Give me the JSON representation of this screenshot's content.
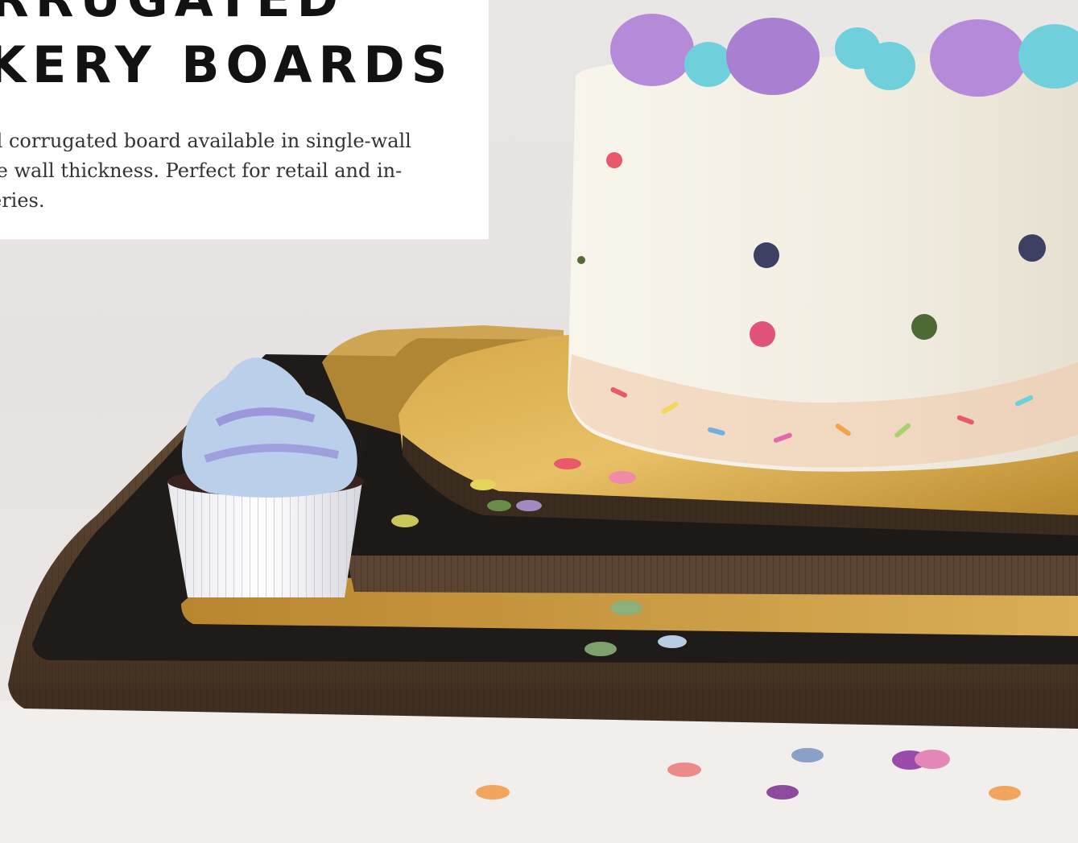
{
  "hero": {
    "heading_line1": "RRUGATED",
    "heading_line2": "KERY BOARDS",
    "description_lines": [
      "d corrugated board available in single-wall",
      "le wall thickness. Perfect for retail and in-",
      "eries."
    ]
  },
  "colors": {
    "background": "#ece8e6",
    "card": "#ffffff",
    "heading_text": "#121212",
    "body_text": "#333333",
    "board_black": "#1f1b19",
    "board_gold": "#c99a3a",
    "cardboard_edge": "#5a4330",
    "frosting_purple": "#b48ad9",
    "frosting_teal": "#6fd0dc",
    "frosting_blue": "#b9cfea",
    "cake_frosting": "#f3efe4"
  },
  "illustration": {
    "subjects": [
      "cake-icon",
      "cupcake-icon",
      "cake-board-stack-icon",
      "sprinkles-icon"
    ]
  }
}
